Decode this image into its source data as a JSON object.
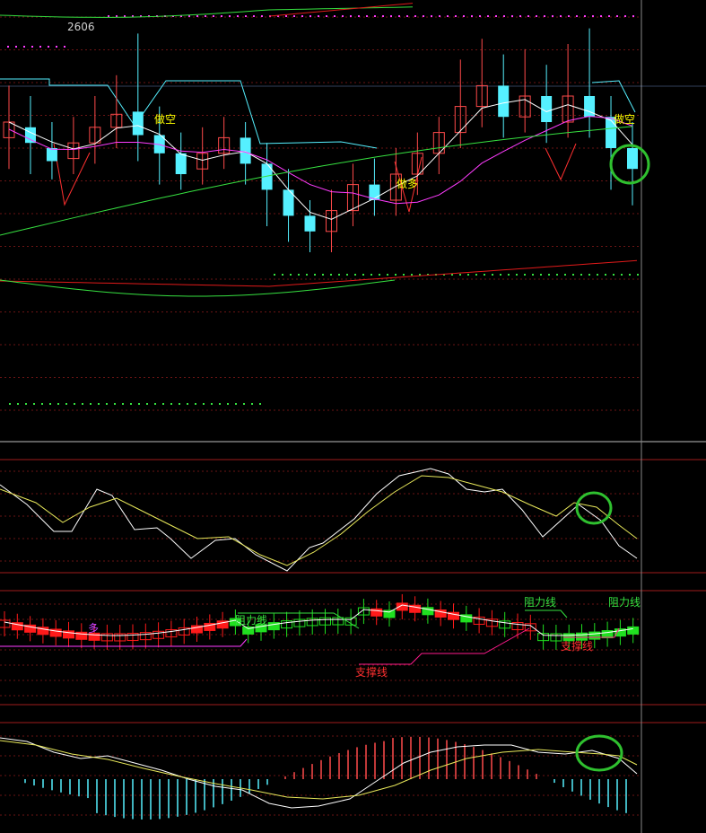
{
  "chart_data": [
    {
      "type": "candlestick",
      "panel": "main",
      "price_label": "2606",
      "signals": [
        {
          "text": "做空",
          "x_index": 6
        },
        {
          "text": "做多",
          "x_index": 17
        },
        {
          "text": "做空",
          "x_index": 28
        }
      ],
      "colors": {
        "up": "#ff4a4a",
        "down": "#55f0ff",
        "ma_white": "#ffffff",
        "ma_magenta": "#ff3cff",
        "ma_green": "#36e040",
        "band_red": "#e01a1a",
        "stop": "#55f0ff",
        "signal": "#ffff00"
      },
      "candles": [
        [
          0.54,
          0.6,
          0.42,
          0.74
        ],
        [
          0.58,
          0.52,
          0.4,
          0.7
        ],
        [
          0.5,
          0.45,
          0.38,
          0.6
        ],
        [
          0.46,
          0.52,
          0.4,
          0.62
        ],
        [
          0.52,
          0.58,
          0.44,
          0.7
        ],
        [
          0.58,
          0.63,
          0.5,
          0.78
        ],
        [
          0.64,
          0.55,
          0.45,
          0.94
        ],
        [
          0.55,
          0.48,
          0.36,
          0.66
        ],
        [
          0.48,
          0.4,
          0.34,
          0.56
        ],
        [
          0.42,
          0.48,
          0.36,
          0.58
        ],
        [
          0.48,
          0.54,
          0.42,
          0.62
        ],
        [
          0.54,
          0.44,
          0.36,
          0.6
        ],
        [
          0.44,
          0.34,
          0.2,
          0.52
        ],
        [
          0.34,
          0.24,
          0.14,
          0.42
        ],
        [
          0.24,
          0.18,
          0.1,
          0.3
        ],
        [
          0.18,
          0.26,
          0.1,
          0.34
        ],
        [
          0.26,
          0.36,
          0.2,
          0.44
        ],
        [
          0.36,
          0.3,
          0.24,
          0.46
        ],
        [
          0.3,
          0.4,
          0.24,
          0.5
        ],
        [
          0.4,
          0.48,
          0.32,
          0.56
        ],
        [
          0.48,
          0.56,
          0.4,
          0.62
        ],
        [
          0.56,
          0.66,
          0.5,
          0.84
        ],
        [
          0.66,
          0.74,
          0.58,
          0.92
        ],
        [
          0.74,
          0.62,
          0.54,
          0.86
        ],
        [
          0.62,
          0.7,
          0.56,
          0.88
        ],
        [
          0.7,
          0.6,
          0.52,
          0.82
        ],
        [
          0.6,
          0.7,
          0.54,
          0.9
        ],
        [
          0.7,
          0.62,
          0.54,
          0.96
        ],
        [
          0.62,
          0.5,
          0.34,
          0.7
        ],
        [
          0.5,
          0.42,
          0.28,
          0.6
        ]
      ]
    },
    {
      "type": "line",
      "panel": "oscillator",
      "series_colors": [
        "#ffffff",
        "#e8e85a"
      ]
    },
    {
      "type": "candlestick",
      "panel": "support-resistance",
      "annotations": [
        {
          "text": "多",
          "color": "#c040ff"
        },
        {
          "text": "阻力线",
          "color": "#36e040"
        },
        {
          "text": "支撑线",
          "color": "#ff3030"
        },
        {
          "text": "阻力线",
          "color": "#36e040"
        },
        {
          "text": "支撑线",
          "color": "#ff3030"
        },
        {
          "text": "阻力线",
          "color": "#36e040"
        }
      ]
    },
    {
      "type": "line",
      "panel": "macd",
      "series_colors": [
        "#ffffff",
        "#e8e85a"
      ],
      "histogram_colors": {
        "pos": "#ff4a4a",
        "neg": "#55f0ff"
      }
    }
  ]
}
